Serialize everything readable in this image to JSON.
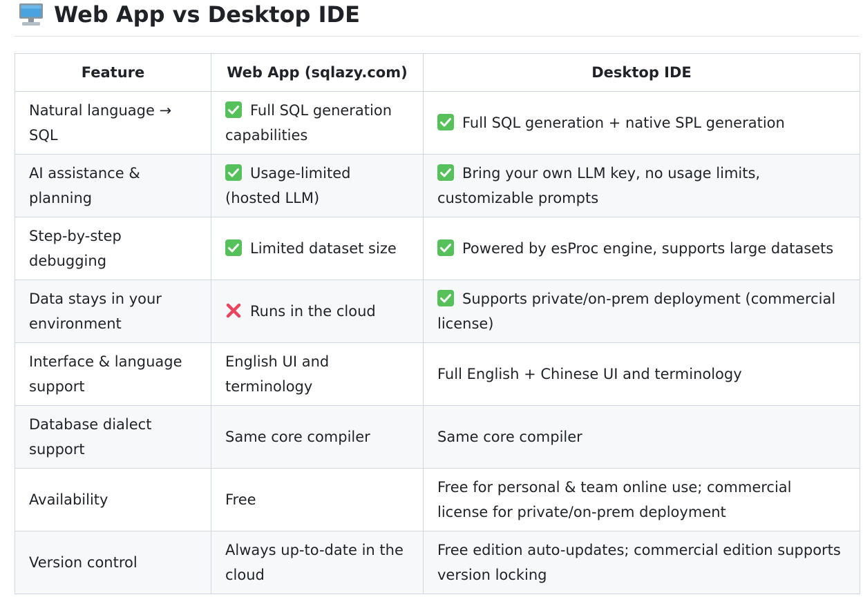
{
  "title": "Web App vs Desktop IDE",
  "title_icon": "desktop-computer-icon",
  "table": {
    "headers": [
      "Feature",
      "Web App (sqlazy.com)",
      "Desktop IDE"
    ],
    "rows": [
      {
        "feature": "Natural language → SQL",
        "web": {
          "icon": "check",
          "text": "Full SQL generation capabilities"
        },
        "desktop": {
          "icon": "check",
          "text": "Full SQL generation + native SPL generation"
        }
      },
      {
        "feature": "AI assistance & planning",
        "web": {
          "icon": "check",
          "text": "Usage-limited (hosted LLM)"
        },
        "desktop": {
          "icon": "check",
          "text": "Bring your own LLM key, no usage limits, customizable prompts"
        }
      },
      {
        "feature": "Step-by-step debugging",
        "web": {
          "icon": "check",
          "text": "Limited dataset size"
        },
        "desktop": {
          "icon": "check",
          "text": "Powered by esProc engine, supports large datasets"
        }
      },
      {
        "feature": "Data stays in your environment",
        "web": {
          "icon": "cross",
          "text": "Runs in the cloud"
        },
        "desktop": {
          "icon": "check",
          "text": "Supports private/on-prem deployment (commercial license)"
        }
      },
      {
        "feature": "Interface & language support",
        "web": {
          "icon": "",
          "text": "English UI and terminology"
        },
        "desktop": {
          "icon": "",
          "text": "Full English + Chinese UI and terminology"
        }
      },
      {
        "feature": "Database dialect support",
        "web": {
          "icon": "",
          "text": "Same core compiler"
        },
        "desktop": {
          "icon": "",
          "text": "Same core compiler"
        }
      },
      {
        "feature": "Availability",
        "web": {
          "icon": "",
          "text": "Free"
        },
        "desktop": {
          "icon": "",
          "text": "Free for personal & team online use; commercial license for private/on-prem deployment"
        }
      },
      {
        "feature": "Version control",
        "web": {
          "icon": "",
          "text": "Always up-to-date in the cloud"
        },
        "desktop": {
          "icon": "",
          "text": "Free edition auto-updates; commercial edition supports version locking"
        }
      }
    ]
  },
  "colors": {
    "check_green": "#56c15a",
    "cross_red": "#e8455f",
    "stripe": "#f6f8fa",
    "border": "#d0d7de"
  }
}
